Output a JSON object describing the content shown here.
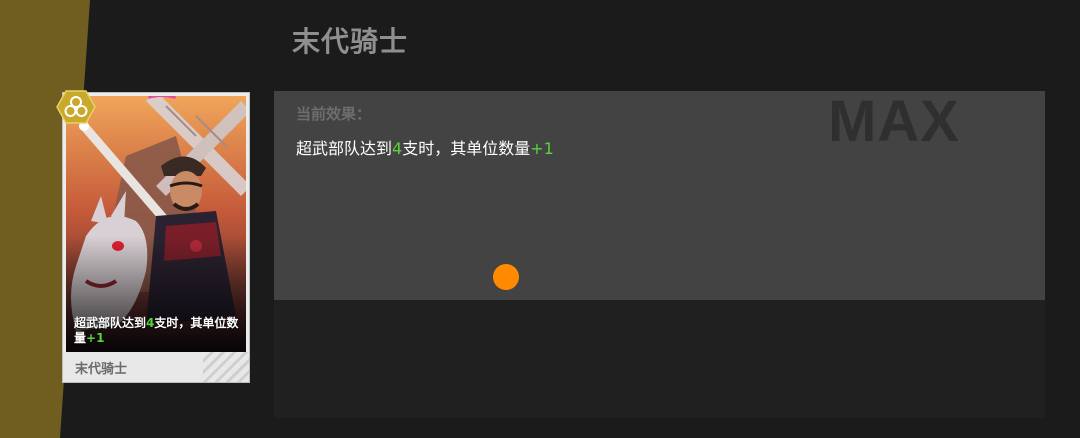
{
  "title": "末代骑士",
  "panel": {
    "max_label": "MAX",
    "effect_label": "当前效果：",
    "effect_desc": {
      "part1": "超武部队达到",
      "num1": "4",
      "part2": "支时，其单位数量",
      "num2": "+1"
    }
  },
  "card": {
    "name": "末代骑士",
    "text": {
      "part1": "超武部队达到",
      "num1": "4",
      "part2": "支时，其单位数量",
      "num2": "+1"
    },
    "badge_icon": "triple-circle-icon"
  },
  "colors": {
    "left_bar": "#6f5e1f",
    "highlight_number": "#59d23b",
    "orange_marker": "#ff8a00",
    "panel": "#434343",
    "background": "#1b1b1b"
  }
}
